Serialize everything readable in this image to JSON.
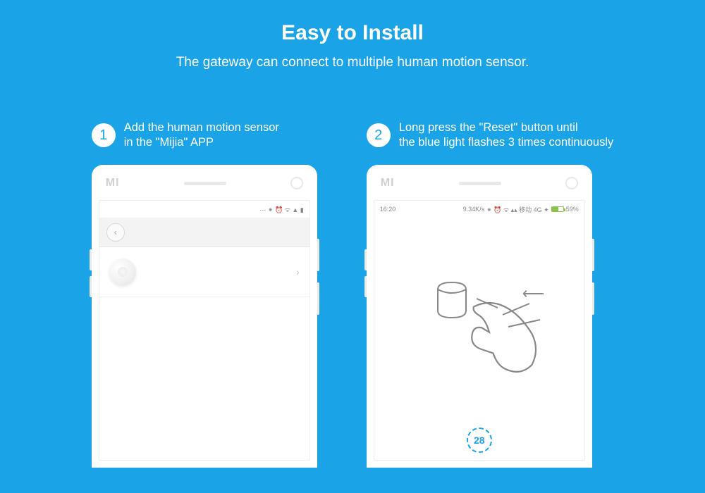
{
  "header": {
    "title": "Easy to Install",
    "subtitle": "The gateway can connect to multiple human motion sensor."
  },
  "steps": [
    {
      "num": "1",
      "line1": "Add the human motion sensor",
      "line2": "in the \"Mijia\" APP"
    },
    {
      "num": "2",
      "line1": "Long press the \"Reset\" button until",
      "line2": "the blue light flashes 3 times continuously"
    }
  ],
  "phone1": {
    "logo": "MI",
    "status_icons": "⋯ ⁕ ⏰ ᯤ ▲ ▮"
  },
  "phone2": {
    "logo": "MI",
    "time": "16:20",
    "net_speed": "9.34K/s",
    "status_mid": "⁕ ⏰ ᯤ ▴▴ 移动 4G ✦",
    "battery_pct": "59%",
    "countdown": "28"
  }
}
